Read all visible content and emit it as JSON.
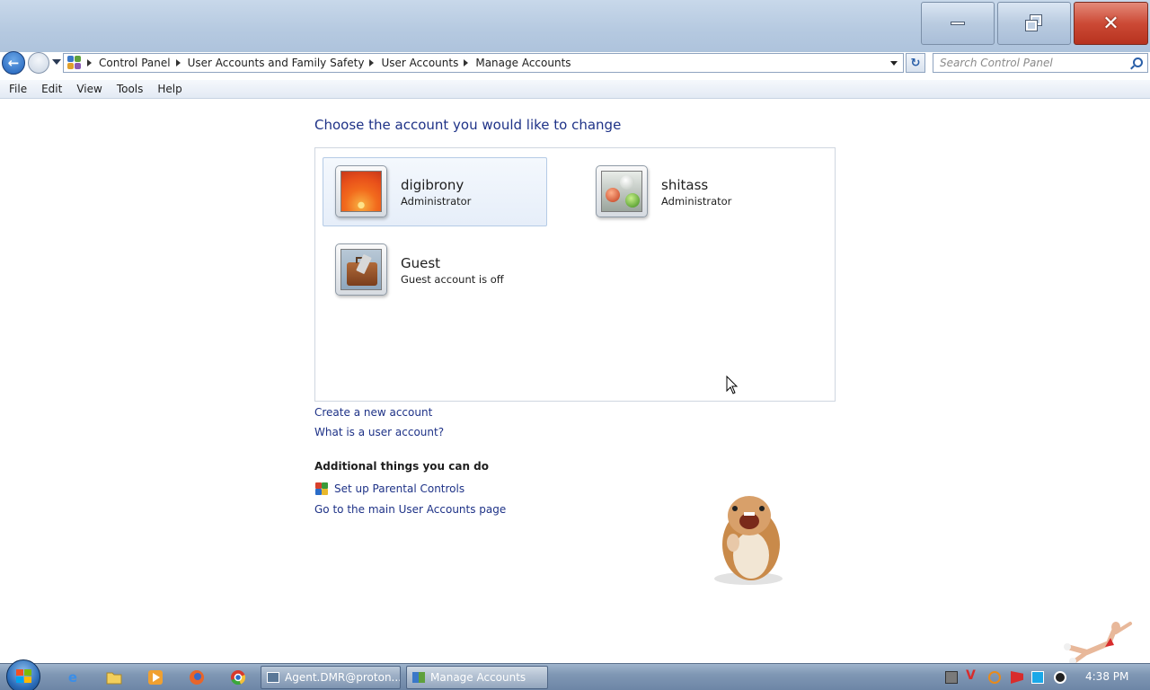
{
  "window": {
    "minimize_label": "",
    "maximize_label": "",
    "close_label": "✕"
  },
  "address_bar": {
    "breadcrumbs": [
      "Control Panel",
      "User Accounts and Family Safety",
      "User Accounts",
      "Manage Accounts"
    ]
  },
  "search": {
    "placeholder": "Search Control Panel"
  },
  "menu": [
    "File",
    "Edit",
    "View",
    "Tools",
    "Help"
  ],
  "main": {
    "title": "Choose the account you would like to change",
    "accounts": [
      {
        "name": "digibrony",
        "role": "Administrator",
        "picture": "orange-flower",
        "selected": true
      },
      {
        "name": "shitass",
        "role": "Administrator",
        "picture": "glass-balls",
        "selected": false
      },
      {
        "name": "Guest",
        "role": "Guest account is off",
        "picture": "briefcase",
        "selected": false
      }
    ],
    "links": {
      "create": "Create a new account",
      "what_is": "What is a user account?"
    },
    "additional": {
      "heading": "Additional things you can do",
      "parental": "Set up Parental Controls",
      "main_page": "Go to the main User Accounts page"
    }
  },
  "taskbar": {
    "pinned": [
      "internet-explorer-icon",
      "folder-icon",
      "media-player-icon",
      "firefox-icon",
      "chrome-icon"
    ],
    "tasks": [
      {
        "label": "Agent.DMR@proton...",
        "active": false
      },
      {
        "label": "Manage Accounts",
        "active": true
      }
    ],
    "clock": "4:38 PM"
  },
  "colors": {
    "link": "#1e3287",
    "close_button": "#cc4a36",
    "selected_account": "#e6eef9"
  }
}
